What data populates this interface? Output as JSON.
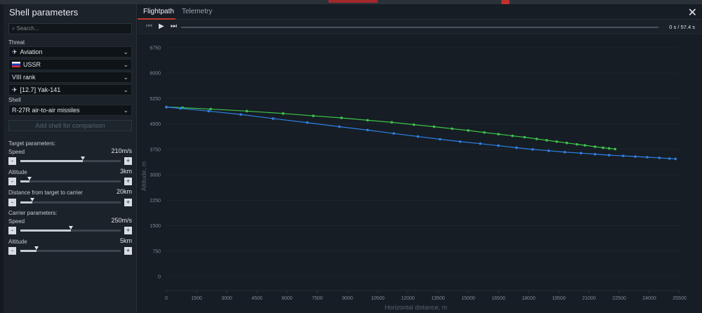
{
  "sidebar": {
    "title": "Shell parameters",
    "search_placeholder": "Search...",
    "threat_label": "Threat",
    "threat_type": "Aviation",
    "nation": "USSR",
    "rank": "VIII rank",
    "vehicle": "[12.7] Yak-141",
    "shell_label": "Shell",
    "shell": "R-27R air-to-air missiles",
    "add_shell": "Add shell for comparison",
    "target_params_label": "Target parameters:",
    "target_speed_label": "Speed",
    "target_speed_value": "210m/s",
    "target_speed_level": 0.62,
    "target_altitude_label": "Altitude",
    "target_altitude_value": "3km",
    "target_altitude_level": 0.09,
    "distance_label": "Distance from target to carrier",
    "distance_value": "20km",
    "distance_level": 0.12,
    "carrier_params_label": "Carrier parameters:",
    "carrier_speed_label": "Speed",
    "carrier_speed_value": "250m/s",
    "carrier_speed_level": 0.5,
    "carrier_altitude_label": "Altitude",
    "carrier_altitude_value": "5km",
    "carrier_altitude_level": 0.16,
    "minus": "-",
    "plus": "+"
  },
  "tabs": [
    {
      "label": "Flightpath",
      "active": true
    },
    {
      "label": "Telemetry",
      "active": false
    }
  ],
  "player": {
    "time_current": "0 s",
    "time_sep": "/",
    "time_total": "57.4 s"
  },
  "colors": {
    "accent": "#c33a2e",
    "series_green": "#3cc44a",
    "series_blue": "#2f7fe6"
  },
  "chart_data": {
    "type": "line",
    "xlabel": "Horizontal distance, m",
    "ylabel": "Altitude, m",
    "xlim": [
      0,
      25500
    ],
    "ylim": [
      0,
      6750
    ],
    "xticks": [
      0,
      1500,
      3000,
      4500,
      6000,
      7500,
      9000,
      10500,
      12000,
      13500,
      15000,
      16500,
      18000,
      19500,
      21000,
      22500,
      24000,
      25500
    ],
    "yticks": [
      0,
      750,
      1500,
      2250,
      3000,
      3750,
      4500,
      5250,
      6000,
      6750
    ],
    "grid": true,
    "series": [
      {
        "color": "#3cc44a",
        "x": [
          0,
          800,
          2200,
          4000,
          5800,
          7300,
          8700,
          10000,
          11200,
          12300,
          13300,
          14200,
          15000,
          15800,
          16500,
          17200,
          17800,
          18400,
          18900,
          19400,
          19900,
          20400,
          20800,
          21300,
          21700,
          22000,
          22300
        ],
        "y": [
          5000,
          4980,
          4940,
          4880,
          4810,
          4740,
          4680,
          4610,
          4550,
          4480,
          4420,
          4360,
          4310,
          4250,
          4200,
          4150,
          4110,
          4060,
          4020,
          3980,
          3940,
          3900,
          3870,
          3830,
          3800,
          3780,
          3760
        ]
      },
      {
        "color": "#2f7fe6",
        "x": [
          0,
          700,
          2100,
          3700,
          5300,
          7000,
          8600,
          10000,
          11300,
          12500,
          13600,
          14600,
          15600,
          16500,
          17400,
          18200,
          19000,
          19800,
          20600,
          21300,
          22000,
          22700,
          23300,
          23900,
          24500,
          25000,
          25300
        ],
        "y": [
          5000,
          4960,
          4880,
          4780,
          4660,
          4540,
          4420,
          4320,
          4220,
          4130,
          4050,
          3980,
          3920,
          3860,
          3800,
          3750,
          3710,
          3670,
          3640,
          3610,
          3580,
          3560,
          3540,
          3520,
          3500,
          3480,
          3470
        ]
      }
    ]
  }
}
